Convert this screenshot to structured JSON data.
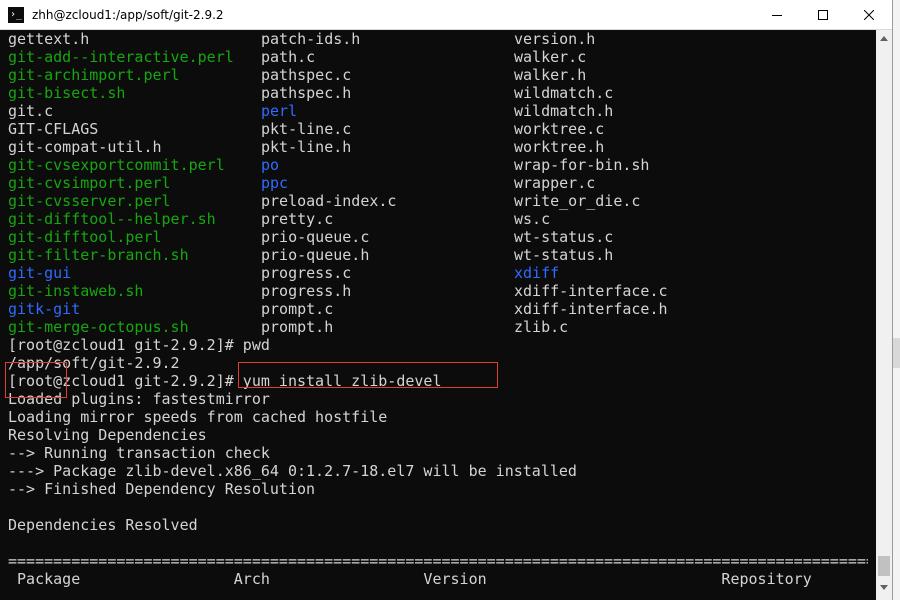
{
  "window": {
    "title": "zhh@zcloud1:/app/soft/git-2.9.2",
    "icon_glyph": "›_",
    "colors": {
      "background": "#0c0c0c",
      "text": "#d4d4d4",
      "executable": "#16a70f",
      "directory": "#2f6bff",
      "highlight": "#e03a3a"
    }
  },
  "listing": [
    [
      {
        "text": "gettext.h",
        "color": "white"
      },
      {
        "text": "patch-ids.h",
        "color": "white"
      },
      {
        "text": "version.h",
        "color": "white"
      }
    ],
    [
      {
        "text": "git-add--interactive.perl",
        "color": "green"
      },
      {
        "text": "path.c",
        "color": "white"
      },
      {
        "text": "walker.c",
        "color": "white"
      }
    ],
    [
      {
        "text": "git-archimport.perl",
        "color": "green"
      },
      {
        "text": "pathspec.c",
        "color": "white"
      },
      {
        "text": "walker.h",
        "color": "white"
      }
    ],
    [
      {
        "text": "git-bisect.sh",
        "color": "green"
      },
      {
        "text": "pathspec.h",
        "color": "white"
      },
      {
        "text": "wildmatch.c",
        "color": "white"
      }
    ],
    [
      {
        "text": "git.c",
        "color": "white"
      },
      {
        "text": "perl",
        "color": "blue"
      },
      {
        "text": "wildmatch.h",
        "color": "white"
      }
    ],
    [
      {
        "text": "GIT-CFLAGS",
        "color": "white"
      },
      {
        "text": "pkt-line.c",
        "color": "white"
      },
      {
        "text": "worktree.c",
        "color": "white"
      }
    ],
    [
      {
        "text": "git-compat-util.h",
        "color": "white"
      },
      {
        "text": "pkt-line.h",
        "color": "white"
      },
      {
        "text": "worktree.h",
        "color": "white"
      }
    ],
    [
      {
        "text": "git-cvsexportcommit.perl",
        "color": "green"
      },
      {
        "text": "po",
        "color": "blue"
      },
      {
        "text": "wrap-for-bin.sh",
        "color": "white"
      }
    ],
    [
      {
        "text": "git-cvsimport.perl",
        "color": "green"
      },
      {
        "text": "ppc",
        "color": "blue"
      },
      {
        "text": "wrapper.c",
        "color": "white"
      }
    ],
    [
      {
        "text": "git-cvsserver.perl",
        "color": "green"
      },
      {
        "text": "preload-index.c",
        "color": "white"
      },
      {
        "text": "write_or_die.c",
        "color": "white"
      }
    ],
    [
      {
        "text": "git-difftool--helper.sh",
        "color": "green"
      },
      {
        "text": "pretty.c",
        "color": "white"
      },
      {
        "text": "ws.c",
        "color": "white"
      }
    ],
    [
      {
        "text": "git-difftool.perl",
        "color": "green"
      },
      {
        "text": "prio-queue.c",
        "color": "white"
      },
      {
        "text": "wt-status.c",
        "color": "white"
      }
    ],
    [
      {
        "text": "git-filter-branch.sh",
        "color": "green"
      },
      {
        "text": "prio-queue.h",
        "color": "white"
      },
      {
        "text": "wt-status.h",
        "color": "white"
      }
    ],
    [
      {
        "text": "git-gui",
        "color": "blue"
      },
      {
        "text": "progress.c",
        "color": "white"
      },
      {
        "text": "xdiff",
        "color": "blue"
      }
    ],
    [
      {
        "text": "git-instaweb.sh",
        "color": "green"
      },
      {
        "text": "progress.h",
        "color": "white"
      },
      {
        "text": "xdiff-interface.c",
        "color": "white"
      }
    ],
    [
      {
        "text": "gitk-git",
        "color": "blue"
      },
      {
        "text": "prompt.c",
        "color": "white"
      },
      {
        "text": "xdiff-interface.h",
        "color": "white"
      }
    ],
    [
      {
        "text": "git-merge-octopus.sh",
        "color": "green"
      },
      {
        "text": "prompt.h",
        "color": "white"
      },
      {
        "text": "zlib.c",
        "color": "white"
      }
    ]
  ],
  "output": [
    "[root@zcloud1 git-2.9.2]# pwd",
    "/app/soft/git-2.9.2",
    "[root@zcloud1 git-2.9.2]# yum install zlib-devel",
    "Loaded plugins: fastestmirror",
    "Loading mirror speeds from cached hostfile",
    "Resolving Dependencies",
    "--> Running transaction check",
    "---> Package zlib-devel.x86_64 0:1.2.7-18.el7 will be installed",
    "--> Finished Dependency Resolution",
    "",
    "Dependencies Resolved",
    "",
    "================================================================================================",
    " Package                 Arch                 Version                          Repository         Size"
  ]
}
